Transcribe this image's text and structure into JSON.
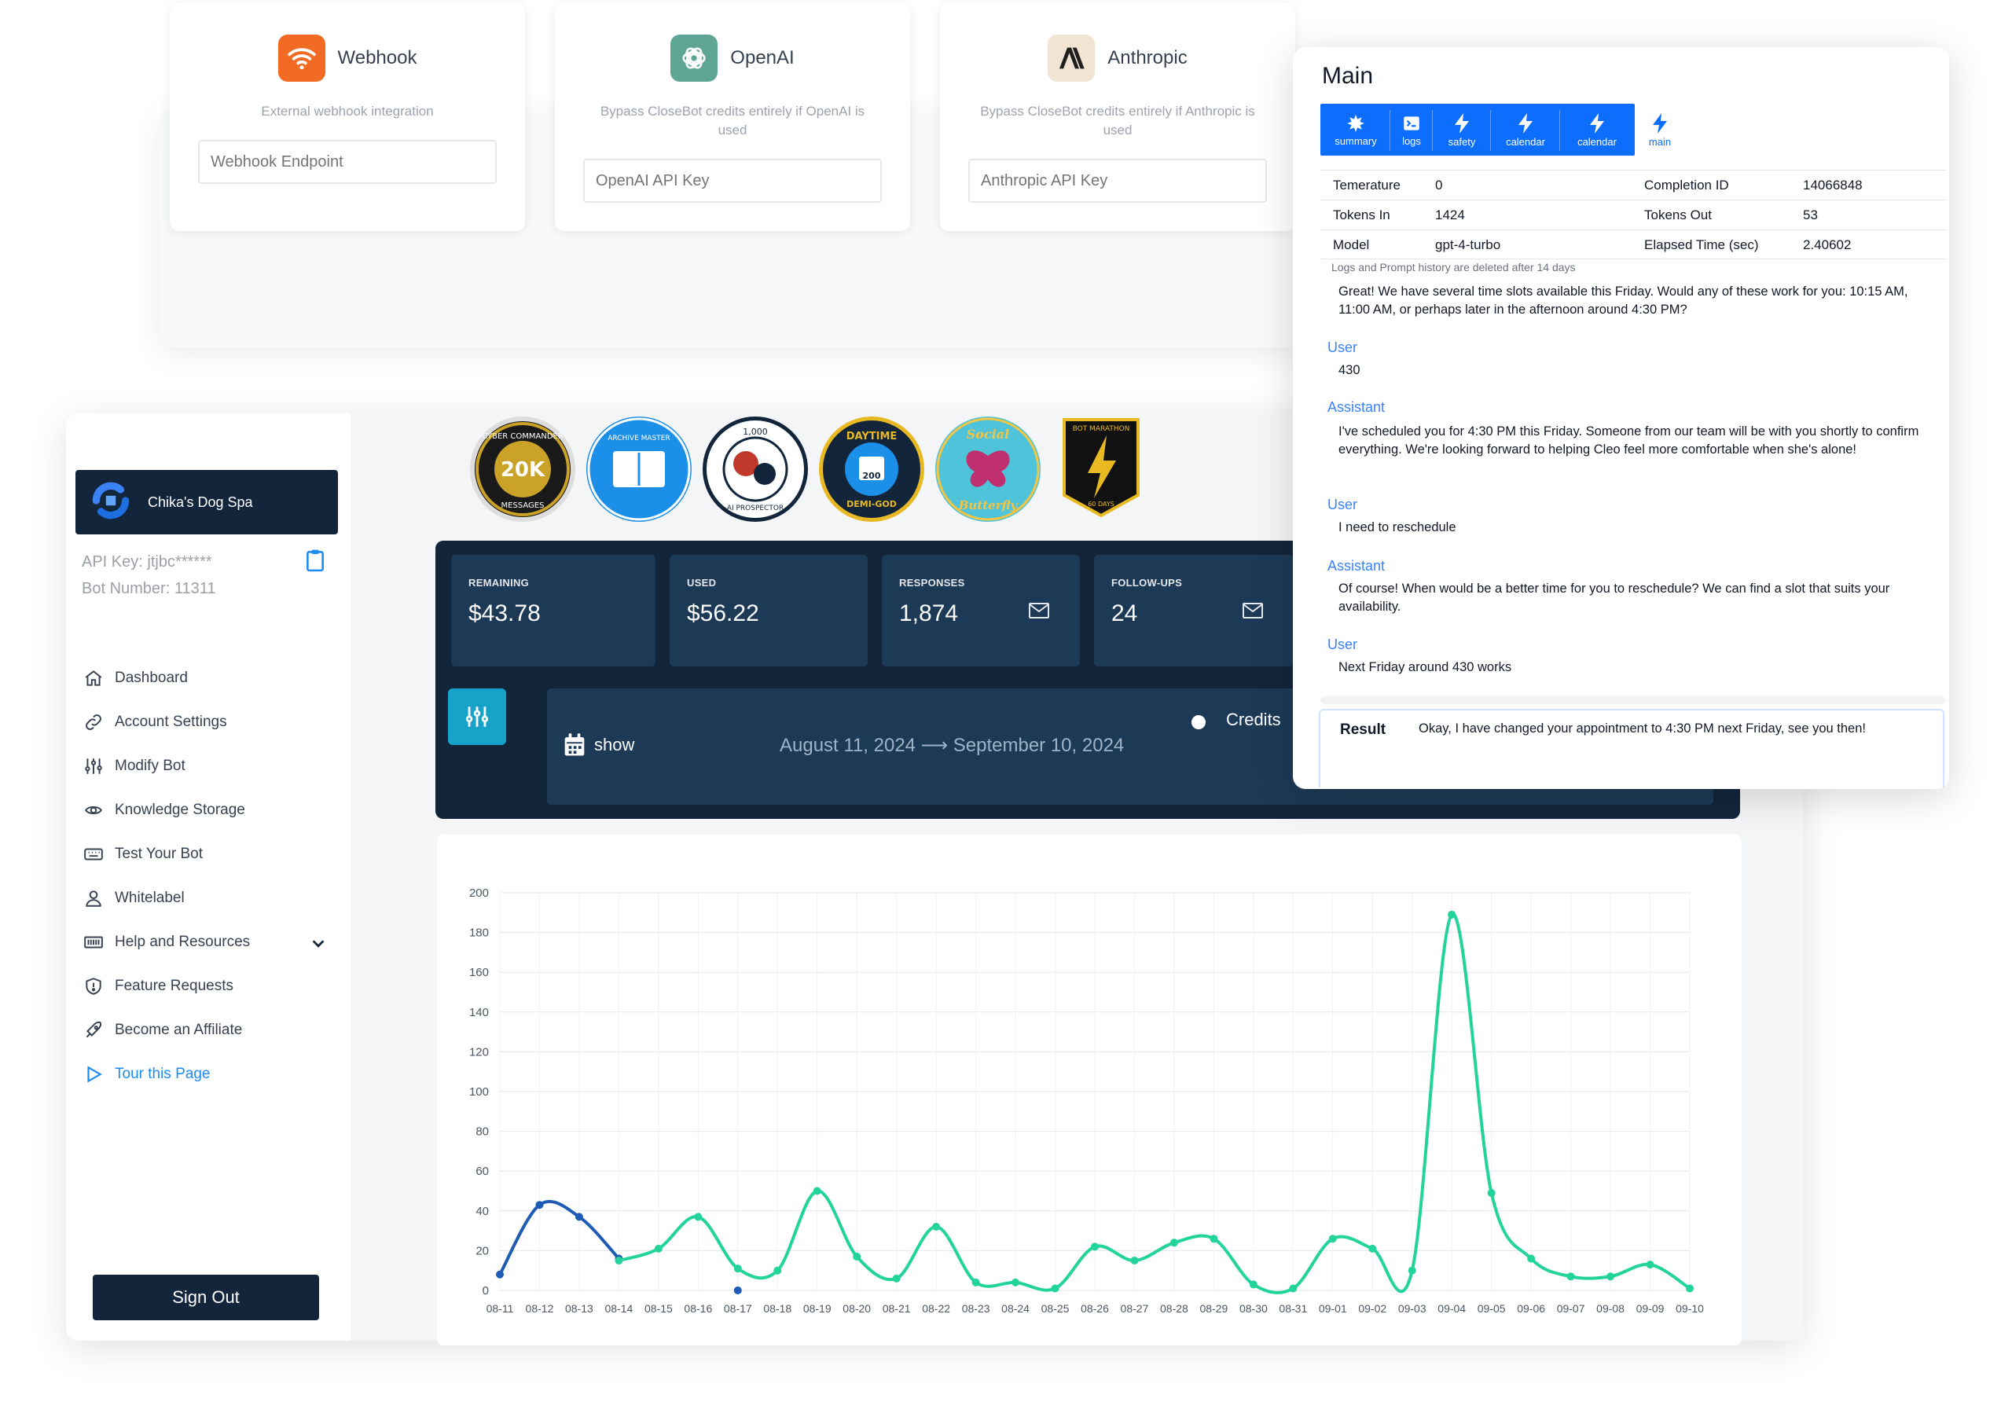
{
  "integrations": [
    {
      "name": "Webhook",
      "description": "External webhook integration",
      "placeholder": "Webhook Endpoint"
    },
    {
      "name": "OpenAI",
      "description": "Bypass CloseBot credits entirely if OpenAI is used",
      "placeholder": "OpenAI API Key"
    },
    {
      "name": "Anthropic",
      "description": "Bypass CloseBot credits entirely if Anthropic is used",
      "placeholder": "Anthropic API Key"
    }
  ],
  "sidebar": {
    "business_name": "Chika's Dog Spa",
    "api_key": "API Key: jtjbc******",
    "bot_number": "Bot Number: 11311",
    "items": [
      {
        "label": "Dashboard",
        "icon": "home-icon"
      },
      {
        "label": "Account Settings",
        "icon": "link-icon"
      },
      {
        "label": "Modify Bot",
        "icon": "sliders-icon"
      },
      {
        "label": "Knowledge Storage",
        "icon": "database-icon"
      },
      {
        "label": "Test Your Bot",
        "icon": "keyboard-icon"
      },
      {
        "label": "Whitelabel",
        "icon": "user-icon"
      },
      {
        "label": "Help and Resources",
        "icon": "book-icon"
      },
      {
        "label": "Feature Requests",
        "icon": "shield-icon"
      },
      {
        "label": "Become an Affiliate",
        "icon": "rocket-icon"
      },
      {
        "label": "Tour this Page",
        "icon": "play-icon"
      }
    ],
    "sign_out": "Sign Out"
  },
  "badges": [
    {
      "line1": "CYBER COMMANDER",
      "big": "20K",
      "line2": "MESSAGES"
    },
    {
      "line1": "ARCHIVE MASTER",
      "big": "",
      "line2": ""
    },
    {
      "line1": "1,000",
      "big": "",
      "line2": "AI PROSPECTOR"
    },
    {
      "line1": "DAYTIME",
      "big": "200",
      "line2": "DEMI-GOD"
    },
    {
      "line1": "Social",
      "big": "",
      "line2": "Butterfly"
    },
    {
      "line1": "BOT MARATHON",
      "big": "",
      "line2": "60 DAYS"
    }
  ],
  "stats": [
    {
      "label": "REMAINING",
      "value": "$43.78"
    },
    {
      "label": "USED",
      "value": "$56.22"
    },
    {
      "label": "RESPONSES",
      "value": "1,874"
    },
    {
      "label": "FOLLOW-UPS",
      "value": "24"
    }
  ],
  "range": {
    "show_label": "show",
    "dates": "August 11, 2024 ⟶ September 10, 2024",
    "legend": "Credits"
  },
  "chart_data": {
    "type": "line",
    "categories": [
      "08-11",
      "08-12",
      "08-13",
      "08-14",
      "08-15",
      "08-16",
      "08-17",
      "08-18",
      "08-19",
      "08-20",
      "08-21",
      "08-22",
      "08-23",
      "08-24",
      "08-25",
      "08-26",
      "08-27",
      "08-28",
      "08-29",
      "08-30",
      "08-31",
      "09-01",
      "09-02",
      "09-03",
      "09-04",
      "09-05",
      "09-06",
      "09-07",
      "09-08",
      "09-09",
      "09-10"
    ],
    "series": [
      {
        "name": "",
        "color": "#1e5bb5",
        "values": [
          8,
          43,
          37,
          16,
          null,
          null,
          0,
          null,
          null,
          null,
          null,
          null,
          null,
          null,
          null,
          null,
          null,
          null,
          null,
          null,
          null,
          null,
          null,
          null,
          null,
          null,
          null,
          null,
          null,
          null,
          null
        ]
      },
      {
        "name": "",
        "color": "#22d39a",
        "values": [
          null,
          null,
          null,
          15,
          21,
          37,
          11,
          10,
          50,
          17,
          6,
          32,
          4,
          4,
          1,
          22,
          15,
          24,
          26,
          3,
          1,
          26,
          21,
          10,
          189,
          49,
          16,
          7,
          7,
          13,
          1
        ]
      }
    ],
    "yticks": [
      0,
      20,
      40,
      60,
      80,
      100,
      120,
      140,
      160,
      180,
      200
    ],
    "ylim": [
      0,
      200
    ],
    "grid": true
  },
  "main_panel": {
    "title": "Main",
    "tabs": [
      {
        "label": "summary",
        "icon": "robot-icon",
        "active": false
      },
      {
        "label": "logs",
        "icon": "terminal-icon",
        "active": false
      },
      {
        "label": "safety",
        "icon": "bolt-icon",
        "active": false
      },
      {
        "label": "calendar",
        "icon": "bolt-icon",
        "active": false
      },
      {
        "label": "calendar",
        "icon": "bolt-icon",
        "active": false
      },
      {
        "label": "main",
        "icon": "bolt-icon",
        "active": true
      }
    ],
    "kv": [
      {
        "k1": "Temerature",
        "v1": "0",
        "k2": "Completion ID",
        "v2": "14066848"
      },
      {
        "k1": "Tokens In",
        "v1": "1424",
        "k2": "Tokens Out",
        "v2": "53"
      },
      {
        "k1": "Model",
        "v1": "gpt-4-turbo",
        "k2": "Elapsed Time (sec)",
        "v2": "2.40602"
      }
    ],
    "note": "Logs and Prompt history are deleted after 14 days",
    "messages": [
      {
        "role": "",
        "text": "Great! We have several time slots available this Friday. Would any of these work for you: 10:15 AM, 11:00 AM, or perhaps later in the afternoon around 4:30 PM?"
      },
      {
        "role": "User",
        "text": "430"
      },
      {
        "role": "Assistant",
        "text": "I've scheduled you for 4:30 PM this Friday. Someone from our team will be with you shortly to confirm everything. We're looking forward to helping Cleo feel more comfortable when she's alone!"
      },
      {
        "role": "User",
        "text": "I need to reschedule"
      },
      {
        "role": "Assistant",
        "text": "Of course! When would be a better time for you to reschedule? We can find a slot that suits your availability."
      },
      {
        "role": "User",
        "text": "Next Friday around 430 works"
      }
    ],
    "result_label": "Result",
    "result_text": "Okay, I have changed your appointment to 4:30 PM next Friday, see you then!"
  }
}
